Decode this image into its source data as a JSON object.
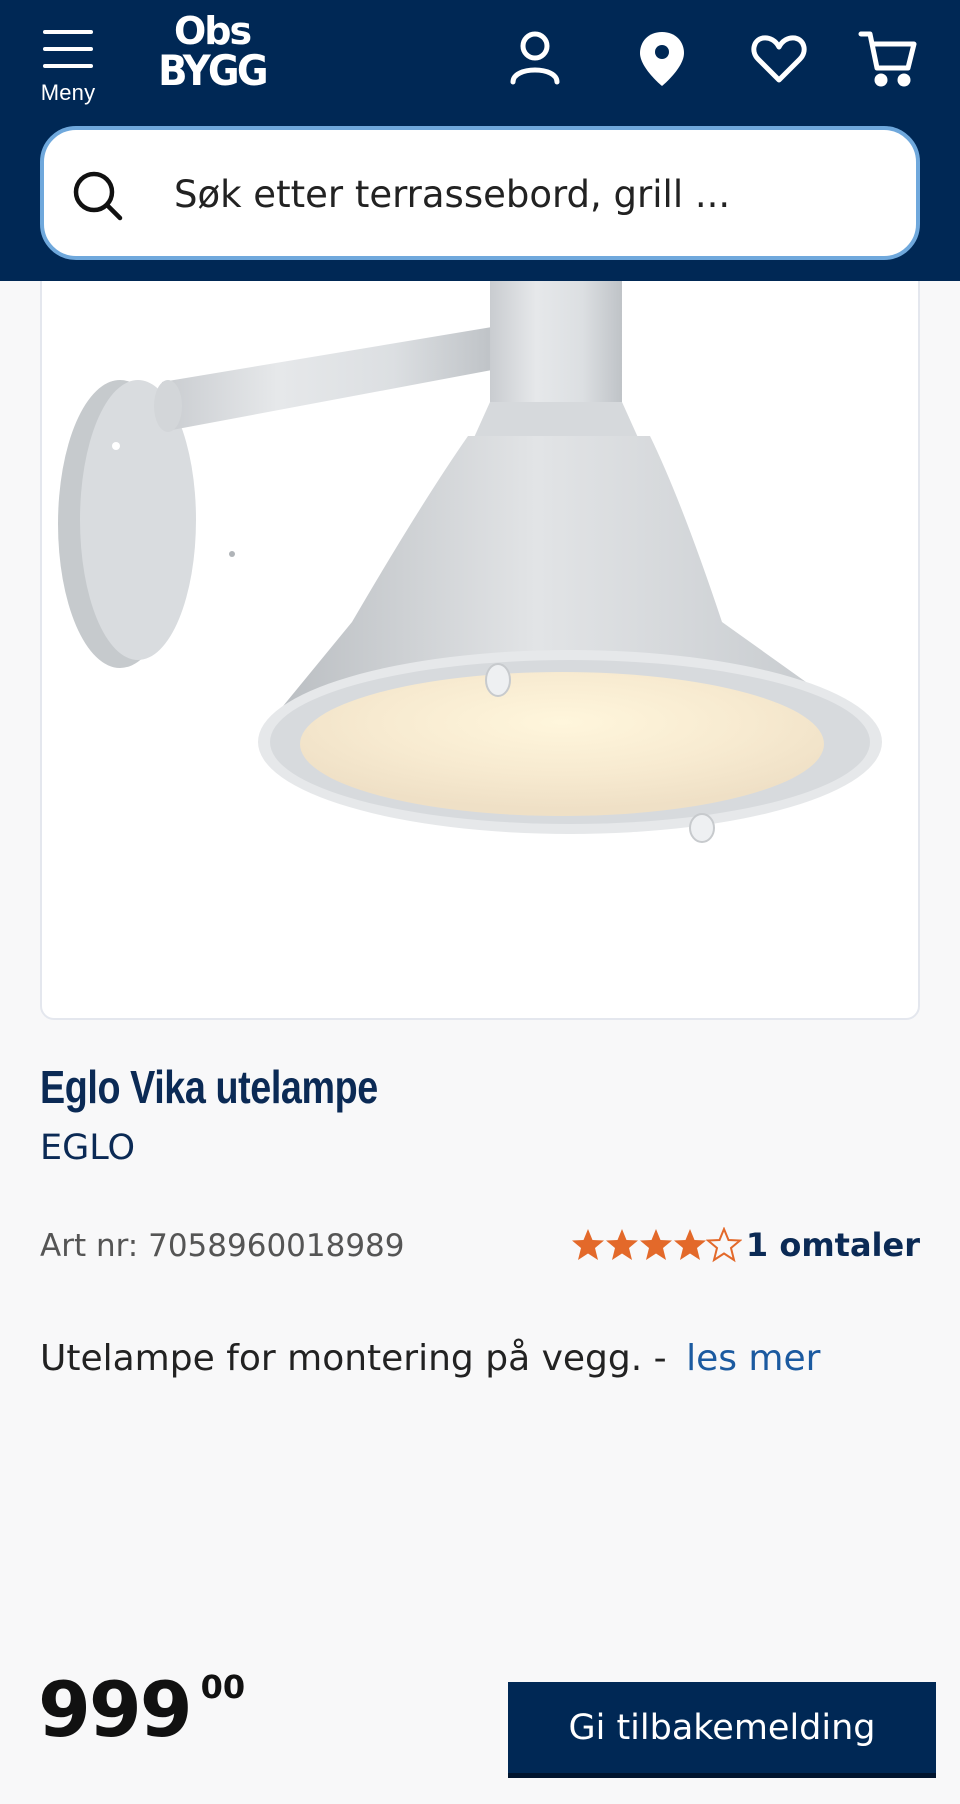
{
  "header": {
    "menu_label": "Meny",
    "logo_line1": "Obs",
    "logo_line2": "BYGG",
    "icons": [
      "user-icon",
      "location-pin-icon",
      "heart-icon",
      "cart-icon"
    ]
  },
  "search": {
    "placeholder": "Søk etter terrassebord, grill ..."
  },
  "product": {
    "image_alt": "Eglo Vika utelampe",
    "title": "Eglo Vika utelampe",
    "brand": "EGLO",
    "art_nr": "Art nr: 7058960018989",
    "rating": {
      "value": 4,
      "max": 5,
      "count_label": "1 omtaler"
    },
    "description": "Utelampe for montering på vegg. -",
    "read_more": "les mer"
  },
  "price": {
    "integer": "999",
    "decimal": "00"
  },
  "cta": {
    "label": "Gi tilbakemelding"
  },
  "colors": {
    "header_bg": "#002855",
    "search_border": "#6fa8dc",
    "title": "#0b2a55",
    "star": "#e3692a",
    "link": "#1b5aa0"
  }
}
